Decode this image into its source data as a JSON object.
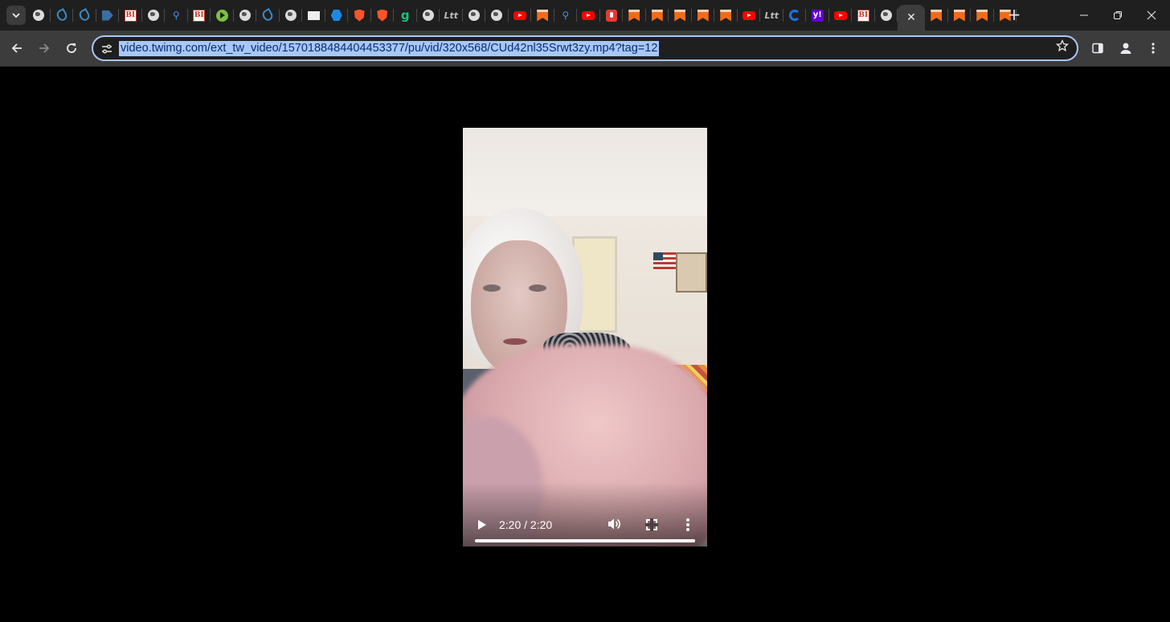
{
  "tabs": [
    {
      "icon": "globe-icon"
    },
    {
      "icon": "leaf-icon"
    },
    {
      "icon": "leaf-icon"
    },
    {
      "icon": "flag-icon"
    },
    {
      "icon": "bi-icon",
      "text": "BI"
    },
    {
      "icon": "globe-icon"
    },
    {
      "icon": "search-icon"
    },
    {
      "icon": "bi-icon",
      "text": "BI"
    },
    {
      "icon": "play-circle-icon"
    },
    {
      "icon": "globe-icon"
    },
    {
      "icon": "leaf-icon"
    },
    {
      "icon": "globe-icon"
    },
    {
      "icon": "news-icon"
    },
    {
      "icon": "hexagon-icon"
    },
    {
      "icon": "shield-icon"
    },
    {
      "icon": "shield-icon"
    },
    {
      "icon": "g-icon",
      "text": "g"
    },
    {
      "icon": "globe-icon"
    },
    {
      "icon": "eth-icon",
      "text": "Ltt"
    },
    {
      "icon": "globe-icon"
    },
    {
      "icon": "globe-icon"
    },
    {
      "icon": "youtube-icon"
    },
    {
      "icon": "bookmark-icon"
    },
    {
      "icon": "search-icon"
    },
    {
      "icon": "youtube-icon"
    },
    {
      "icon": "mic-icon"
    },
    {
      "icon": "bookmark-icon"
    },
    {
      "icon": "bookmark-icon"
    },
    {
      "icon": "bookmark-icon"
    },
    {
      "icon": "bookmark-icon"
    },
    {
      "icon": "bookmark-icon"
    },
    {
      "icon": "youtube-icon"
    },
    {
      "icon": "eth-icon",
      "text": "Ltt"
    },
    {
      "icon": "c-icon"
    },
    {
      "icon": "yahoo-icon",
      "text": "y!"
    },
    {
      "icon": "youtube-icon"
    },
    {
      "icon": "bi-icon",
      "text": "BI"
    },
    {
      "icon": "globe-icon"
    },
    {
      "icon": "close-icon",
      "active": true
    },
    {
      "icon": "bookmark-icon"
    },
    {
      "icon": "bookmark-icon"
    },
    {
      "icon": "bookmark-icon"
    },
    {
      "icon": "bookmark-icon"
    }
  ],
  "address_bar": {
    "url": "video.twimg.com/ext_tw_video/1570188484404453377/pu/vid/320x568/CUd42nl35Srwt3zy.mp4?tag=12"
  },
  "video": {
    "time_display": "2:20 / 2:20",
    "progress": 1.0
  },
  "colors": {
    "tabstrip_bg": "#1f1f1f",
    "toolbar_bg": "#3c3c3c",
    "omnibox_border": "#a8c7fa",
    "url_highlight": "#a8c7fa"
  }
}
